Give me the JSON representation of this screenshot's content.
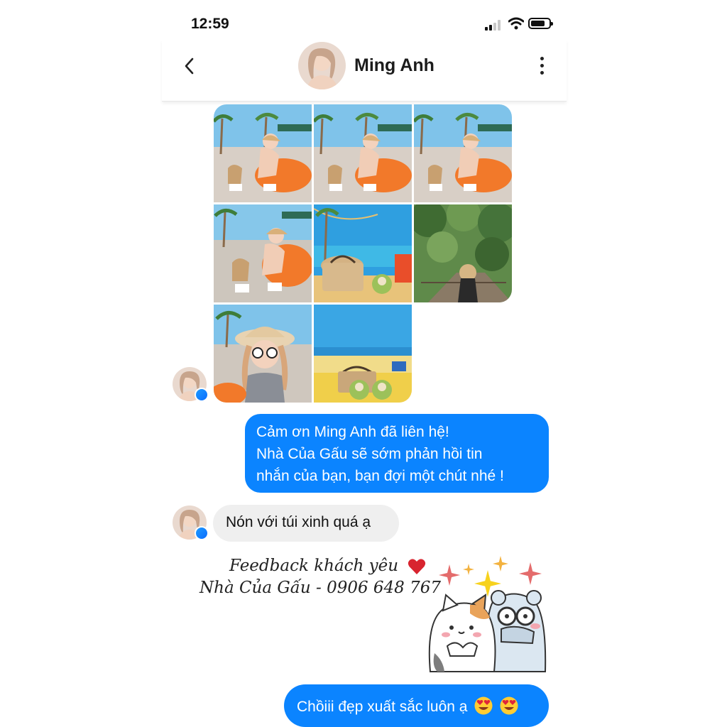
{
  "status_bar": {
    "time": "12:59",
    "battery_level": 0.8
  },
  "header": {
    "contact_name": "Ming Anh"
  },
  "gallery": {
    "photos": [
      {
        "icon": "beach-photo-icon"
      },
      {
        "icon": "beach-photo-icon"
      },
      {
        "icon": "beach-photo-icon"
      },
      {
        "icon": "beach-photo-icon"
      },
      {
        "icon": "beach-bag-photo-icon"
      },
      {
        "icon": "forest-photo-icon"
      },
      {
        "icon": "beach-photo-icon"
      },
      {
        "icon": "beach-bag-photo-icon"
      }
    ]
  },
  "messages": [
    {
      "direction": "outgoing",
      "lines": [
        "Cảm ơn Ming Anh  đã liên hệ!",
        "Nhà Của Gấu sẽ sớm phản hồi tin",
        "nhắn của bạn, bạn đợi một chút nhé !"
      ]
    },
    {
      "direction": "incoming",
      "text": "Nón với túi xinh quá ạ"
    },
    {
      "direction": "outgoing",
      "text": "Chồiii đẹp xuất sắc luôn ạ",
      "emoji": [
        "heart-eyes-emoji-icon",
        "heart-eyes-emoji-icon"
      ]
    }
  ],
  "overlay": {
    "line1": "Feedback khách yêu",
    "line2": "Nhà Của Gấu - 0906 648 767",
    "sticker": "cat-and-bear-sticker-icon"
  },
  "colors": {
    "accent": "#0b84ff",
    "incoming_bubble": "#efefef",
    "heart": "#d8242f"
  }
}
